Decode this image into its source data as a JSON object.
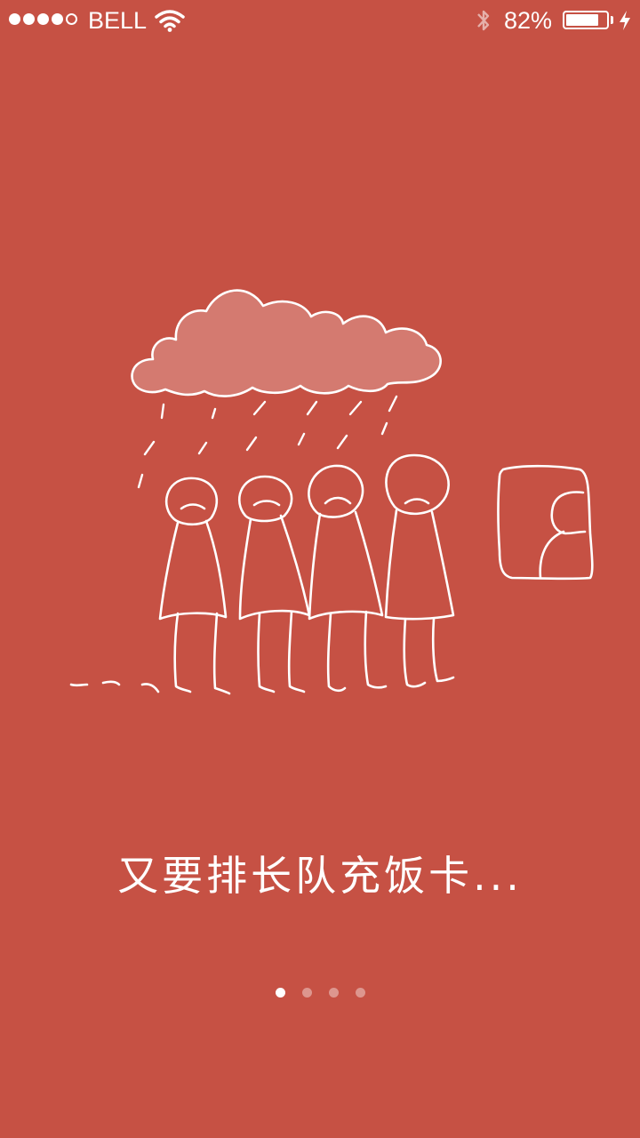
{
  "status_bar": {
    "signal_bars_filled": 4,
    "signal_bars_total": 5,
    "carrier": "BELL",
    "wifi_icon": "wifi-icon",
    "bluetooth_icon": "bluetooth-icon",
    "battery_percent_text": "82%",
    "battery_level": 0.82,
    "charging_icon": "bolt-icon"
  },
  "illustration": {
    "description_icon": "rain-cloud-queue-illustration"
  },
  "caption": {
    "text": "又要排长队充饭卡..."
  },
  "pager": {
    "total": 4,
    "active_index": 0
  },
  "colors": {
    "background": "#c65144",
    "cloud_fill": "#d47a70",
    "stroke": "#ffffff"
  }
}
